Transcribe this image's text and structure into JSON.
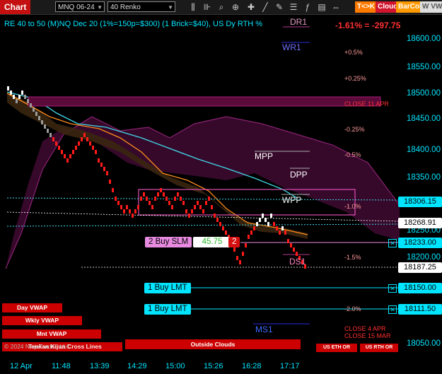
{
  "toolbar": {
    "chart_label": "Chart",
    "instrument": "MNQ 06-24",
    "bar_type": "40 Renko",
    "tck_label": "T<>K",
    "cloud_label": "Cloud",
    "barcol_label": "BarCol",
    "wvwap_label": "W VWA",
    "icons": [
      "bars-icon",
      "bar-style-icon",
      "search-icon",
      "zoom-in-icon",
      "crosshair-icon",
      "draw-line-icon",
      "pencil-icon",
      "properties-icon",
      "indicator-icon",
      "template-icon",
      "scroll-icon"
    ]
  },
  "chart": {
    "title": "RE 40 to 50 (M)NQ Dec 20 (1%=150p=$300) (1 Brick=$40), US Dy RTH %",
    "change": "-1.61% = -297.75",
    "pct_levels": [
      "+0.5%",
      "+0.25%",
      "-0.25%",
      "-0.5%",
      "-1.0%",
      "-1.5%",
      "-2.0%"
    ],
    "close_labels": [
      "CLOSE 11 APR",
      "CLOSE 4 APR",
      "CLOSE 15 MAR"
    ],
    "pivots": [
      "DR1",
      "WR1",
      "MPP",
      "DPP",
      "WPP",
      "DS1",
      "MS1"
    ],
    "copyright": "© 2024 NinjaTrader, LLC",
    "secondary_overlay": "Tenkan Kijun Cross Lines"
  },
  "y_axis": {
    "labels": [
      "18600.00",
      "18550.00",
      "18500.00",
      "18450.00",
      "18400.00",
      "18350.00",
      "18250.00",
      "18200.00",
      "18050.00"
    ],
    "markers": [
      {
        "value": "18306.15",
        "color": "#00e5ff"
      },
      {
        "value": "18268.91",
        "color": "#ffffff"
      },
      {
        "value": "18233.00",
        "color": "#00e5ff"
      },
      {
        "value": "18187.25",
        "color": "#ffffff"
      },
      {
        "value": "18150.00",
        "color": "#00e5ff"
      },
      {
        "value": "18111.50",
        "color": "#00e5ff"
      }
    ]
  },
  "x_axis": [
    "12 Apr",
    "11:48",
    "13:39",
    "14:29",
    "15:00",
    "15:26",
    "16:28",
    "17:17"
  ],
  "orders": [
    {
      "label": "2 Buy SLM",
      "pnl": "45.75",
      "qty": "2"
    },
    {
      "label": "1 Buy LMT"
    },
    {
      "label": "1 Buy LMT"
    }
  ],
  "buttons": {
    "day_vwap": "Day VWAP",
    "wkly_vwap": "Wkly VWAP",
    "mnt_vwap": "Mnt VWAP",
    "outside_clouds": "Outside Clouds",
    "us_eth_or": "US ETH OR",
    "us_rth_or": "US RTH OR"
  }
}
